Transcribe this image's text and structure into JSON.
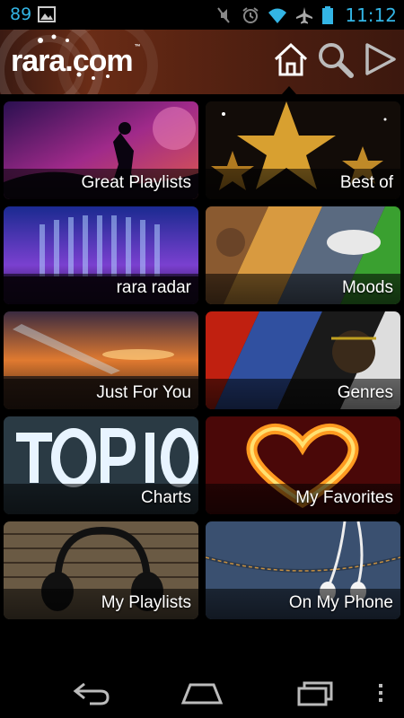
{
  "status_bar": {
    "notification_count": "89",
    "time": "11:12",
    "icons": [
      "image-icon",
      "mute-icon",
      "alarm-icon",
      "wifi-icon",
      "airplane-icon",
      "battery-icon"
    ]
  },
  "header": {
    "logo": "rara.com",
    "logo_tm": "™",
    "buttons": [
      "home-icon",
      "search-icon",
      "play-icon"
    ]
  },
  "tiles": [
    {
      "label": "Great Playlists"
    },
    {
      "label": "Best of"
    },
    {
      "label": "rara radar"
    },
    {
      "label": "Moods"
    },
    {
      "label": "Just For You"
    },
    {
      "label": "Genres"
    },
    {
      "label": "Charts"
    },
    {
      "label": "My Favorites"
    },
    {
      "label": "My Playlists"
    },
    {
      "label": "On My Phone"
    }
  ],
  "nav_bar": {
    "buttons": [
      "back-icon",
      "home-icon",
      "recent-apps-icon",
      "overflow-menu-icon"
    ]
  },
  "colors": {
    "status_accent": "#33b5e5",
    "header_brand": "#6a2c16"
  }
}
